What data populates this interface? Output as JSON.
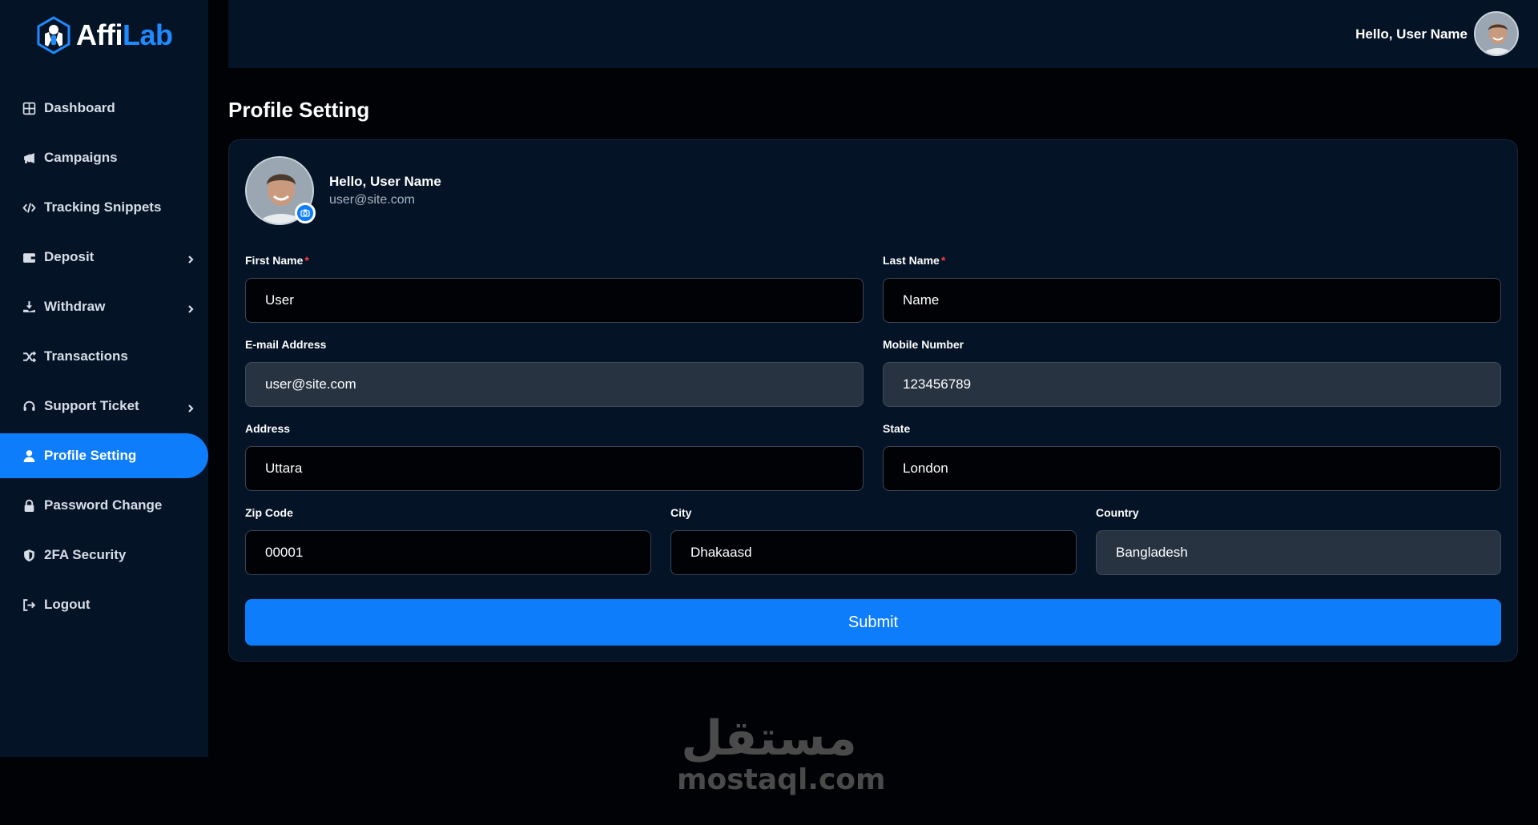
{
  "brand": {
    "name_part1": "Affi",
    "name_part2": "Lab"
  },
  "sidebar": {
    "items": [
      {
        "label": "Dashboard",
        "icon": "dashboard-icon",
        "has_submenu": false,
        "active": false
      },
      {
        "label": "Campaigns",
        "icon": "megaphone-icon",
        "has_submenu": false,
        "active": false
      },
      {
        "label": "Tracking Snippets",
        "icon": "code-icon",
        "has_submenu": false,
        "active": false
      },
      {
        "label": "Deposit",
        "icon": "wallet-icon",
        "has_submenu": true,
        "active": false
      },
      {
        "label": "Withdraw",
        "icon": "withdraw-icon",
        "has_submenu": true,
        "active": false
      },
      {
        "label": "Transactions",
        "icon": "shuffle-icon",
        "has_submenu": false,
        "active": false
      },
      {
        "label": "Support Ticket",
        "icon": "headset-icon",
        "has_submenu": true,
        "active": false
      },
      {
        "label": "Profile Setting",
        "icon": "user-icon",
        "has_submenu": false,
        "active": true
      },
      {
        "label": "Password Change",
        "icon": "lock-icon",
        "has_submenu": false,
        "active": false
      },
      {
        "label": "2FA Security",
        "icon": "shield-icon",
        "has_submenu": false,
        "active": false
      },
      {
        "label": "Logout",
        "icon": "logout-icon",
        "has_submenu": false,
        "active": false
      }
    ]
  },
  "header": {
    "greeting": "Hello, User Name"
  },
  "page": {
    "title": "Profile Setting"
  },
  "profile": {
    "name": "Hello, User Name",
    "email": "user@site.com"
  },
  "form": {
    "first_name": {
      "label": "First Name",
      "required": true,
      "value": "User"
    },
    "last_name": {
      "label": "Last Name",
      "required": true,
      "value": "Name"
    },
    "email": {
      "label": "E-mail Address",
      "value": "user@site.com",
      "readonly": true
    },
    "mobile": {
      "label": "Mobile Number",
      "value": "123456789",
      "readonly": true
    },
    "address": {
      "label": "Address",
      "value": "Uttara"
    },
    "state": {
      "label": "State",
      "value": "London"
    },
    "zip": {
      "label": "Zip Code",
      "value": "00001"
    },
    "city": {
      "label": "City",
      "value": "Dhakaasd"
    },
    "country": {
      "label": "Country",
      "value": "Bangladesh",
      "readonly": true
    },
    "submit_label": "Submit"
  },
  "watermark": {
    "arabic": "مستقل",
    "latin": "mostaql.com"
  },
  "colors": {
    "accent": "#0d7dfb",
    "panel": "#041326",
    "background": "#000205",
    "required": "#ff3b3b",
    "readonly_field": "#283342"
  }
}
